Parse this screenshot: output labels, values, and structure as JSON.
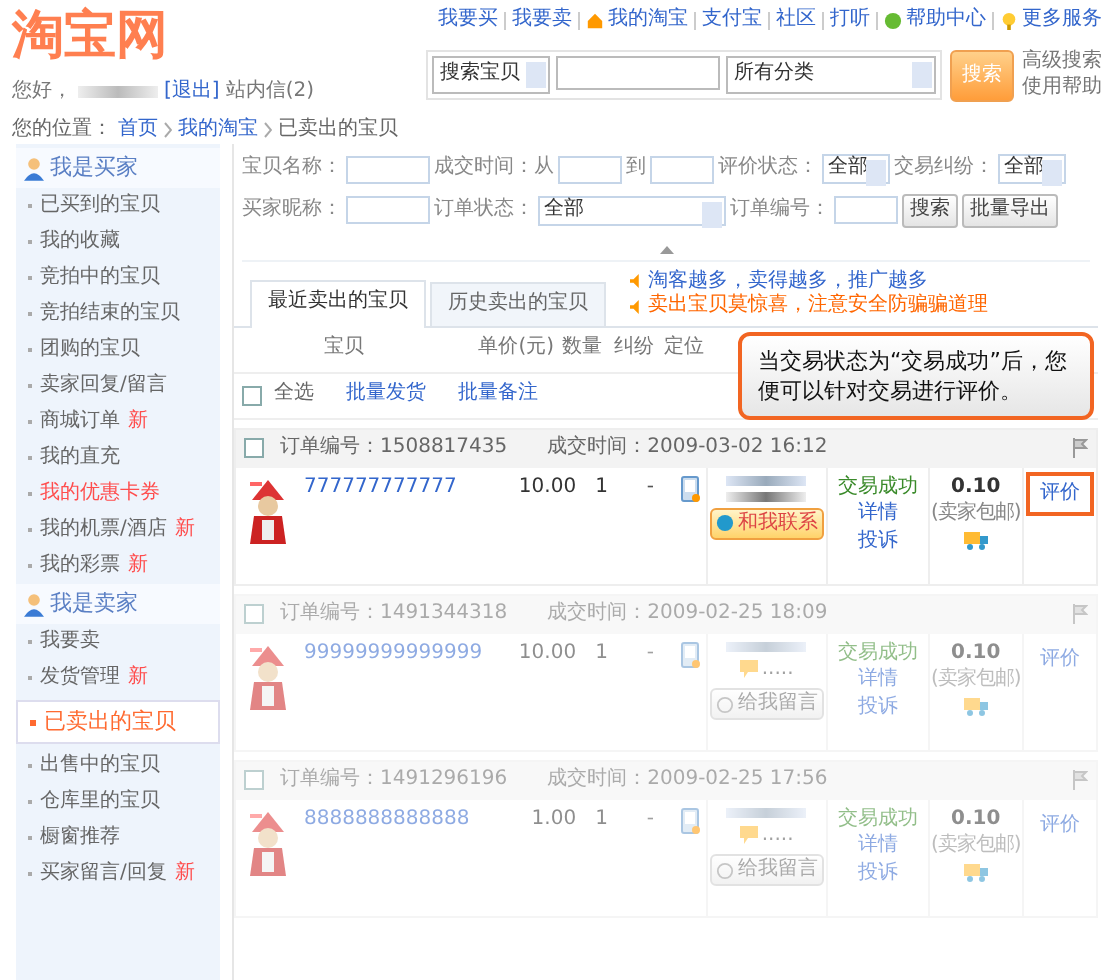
{
  "header": {
    "logo": "淘宝网",
    "top_links": [
      "我要买",
      "我要卖",
      "我的淘宝",
      "支付宝",
      "社区",
      "打听",
      "帮助中心",
      "更多服务"
    ],
    "search": {
      "scope": "搜索宝贝",
      "category": "所有分类",
      "button": "搜索",
      "advanced": "高级搜索",
      "help": "使用帮助"
    },
    "greeting": "您好，",
    "logout": "[退出]",
    "messages": "站内信(2)",
    "breadcrumb": {
      "label": "您的位置：",
      "items": [
        "首页",
        "我的淘宝",
        "已卖出的宝贝"
      ]
    }
  },
  "sidebar": [
    {
      "kind": "header",
      "label": "我是买家"
    },
    {
      "kind": "item",
      "label": "已买到的宝贝",
      "selected": false,
      "highlight": false
    },
    {
      "kind": "item",
      "label": "我的收藏",
      "selected": false,
      "highlight": false
    },
    {
      "kind": "item",
      "label": "竞拍中的宝贝",
      "selected": false,
      "highlight": false
    },
    {
      "kind": "item",
      "label": "竞拍结束的宝贝",
      "selected": false,
      "highlight": false
    },
    {
      "kind": "item",
      "label": "团购的宝贝",
      "selected": false,
      "highlight": false
    },
    {
      "kind": "item",
      "label": "卖家回复/留言",
      "selected": false,
      "highlight": false
    },
    {
      "kind": "item",
      "label": "商城订单",
      "badge": "新",
      "selected": false,
      "highlight": false
    },
    {
      "kind": "item",
      "label": "我的直充",
      "selected": false,
      "highlight": false
    },
    {
      "kind": "item",
      "label": "我的优惠卡券",
      "selected": false,
      "highlight": true
    },
    {
      "kind": "item",
      "label": "我的机票/酒店",
      "badge": "新",
      "selected": false,
      "highlight": false
    },
    {
      "kind": "item",
      "label": "我的彩票",
      "badge": "新",
      "selected": false,
      "highlight": false
    },
    {
      "kind": "header",
      "label": "我是卖家"
    },
    {
      "kind": "item",
      "label": "我要卖",
      "selected": false,
      "highlight": false
    },
    {
      "kind": "item",
      "label": "发货管理",
      "badge": "新",
      "selected": false,
      "highlight": false
    },
    {
      "kind": "item",
      "label": "已卖出的宝贝",
      "selected": true,
      "highlight": false
    },
    {
      "kind": "item",
      "label": "出售中的宝贝",
      "selected": false,
      "highlight": false
    },
    {
      "kind": "item",
      "label": "仓库里的宝贝",
      "selected": false,
      "highlight": false
    },
    {
      "kind": "item",
      "label": "橱窗推荐",
      "selected": false,
      "highlight": false
    },
    {
      "kind": "item",
      "label": "买家留言/回复",
      "badge": "新",
      "selected": false,
      "highlight": false
    }
  ],
  "filters": {
    "item_name": "宝贝名称：",
    "deal_time": "成交时间：从",
    "to": "到",
    "rating_status": "评价状态：",
    "rating_value": "全部",
    "dispute": "交易纠纷：",
    "dispute_value": "全部",
    "buyer": "买家昵称：",
    "order_status": "订单状态：",
    "order_status_value": "全部",
    "order_no": "订单编号：",
    "search": "搜索",
    "export": "批量导出"
  },
  "tabs": [
    {
      "label": "最近卖出的宝贝",
      "selected": true
    },
    {
      "label": "历史卖出的宝贝",
      "selected": false
    }
  ],
  "notices": [
    {
      "text": "淘客越多，卖得越多，推广越多",
      "color": "#3366cc"
    },
    {
      "text": "卖出宝贝莫惊喜，注意安全防骗骗道理",
      "color": "#ff6600"
    }
  ],
  "columns": [
    "宝贝",
    "单价(元)",
    "数量",
    "纠纷",
    "定位"
  ],
  "bulk": {
    "select_all": "全选",
    "checked": false,
    "actions": [
      "批量发货",
      "批量备注"
    ]
  },
  "orders": [
    {
      "order_no": "订单编号：1508817435",
      "time": "成交时间：2009-03-02 16:12",
      "checked": false,
      "dimmed": false,
      "title": "777777777777",
      "price": "10.00",
      "qty": "1",
      "dispute": "-",
      "contact": {
        "kind": "contact",
        "label": "和我联系"
      },
      "status": "交易成功",
      "detail": "详情",
      "complain": "投诉",
      "fee": "0.10",
      "fee_note": "(卖家包邮)",
      "rate": "评价",
      "highlighted": true
    },
    {
      "order_no": "订单编号：1491344318",
      "time": "成交时间：2009-02-25 18:09",
      "checked": false,
      "dimmed": true,
      "title": "99999999999999",
      "price": "10.00",
      "qty": "1",
      "dispute": "-",
      "contact": {
        "kind": "message",
        "label": "给我留言",
        "note": "....."
      },
      "status": "交易成功",
      "detail": "详情",
      "complain": "投诉",
      "fee": "0.10",
      "fee_note": "(卖家包邮)",
      "rate": "评价",
      "highlighted": false
    },
    {
      "order_no": "订单编号：1491296196",
      "time": "成交时间：2009-02-25 17:56",
      "checked": false,
      "dimmed": true,
      "title": "8888888888888",
      "price": "1.00",
      "qty": "1",
      "dispute": "-",
      "contact": {
        "kind": "message",
        "label": "给我留言",
        "note": "....."
      },
      "status": "交易成功",
      "detail": "详情",
      "complain": "投诉",
      "fee": "0.10",
      "fee_note": "(卖家包邮)",
      "rate": "评价",
      "highlighted": false
    }
  ],
  "callout": "当交易状态为“交易成功”后，您便可以针对交易进行评价。"
}
